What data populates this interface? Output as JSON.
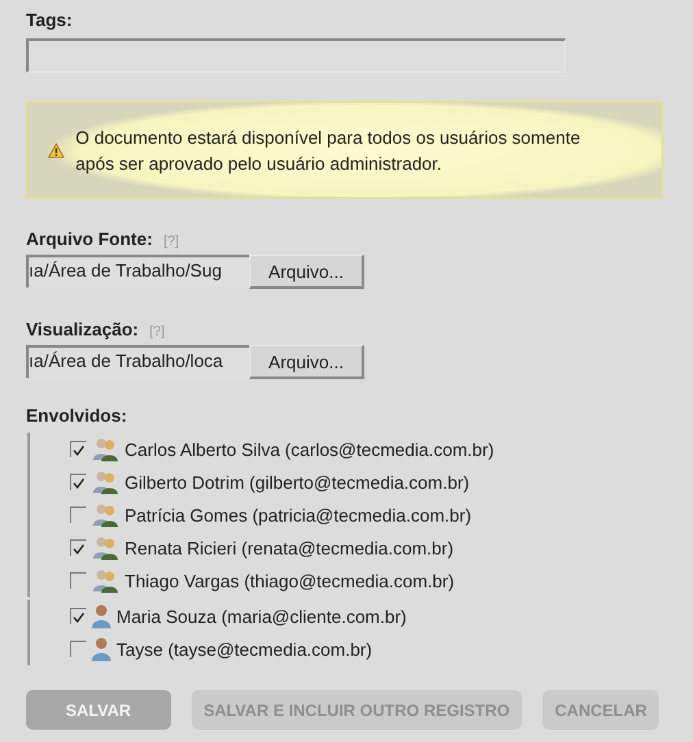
{
  "tags": {
    "label": "Tags:"
  },
  "warning": {
    "text": "O documento estará disponível para todos os usuários somente após ser aprovado pelo usuário administrador."
  },
  "files": [
    {
      "label": "Arquivo Fonte:",
      "help": "[?]",
      "value": "ıa/Área de Trabalho/Sug",
      "button": "Arquivo..."
    },
    {
      "label": "Visualização:",
      "help": "[?]",
      "value": "ıa/Área de Trabalho/loca",
      "button": "Arquivo..."
    }
  ],
  "involved": {
    "label": "Envolvidos:",
    "groups": [
      {
        "kind": "group",
        "members": [
          {
            "name": "Carlos Alberto Silva (carlos@tecmedia.com.br)",
            "checked": true
          },
          {
            "name": "Gilberto Dotrim (gilberto@tecmedia.com.br)",
            "checked": true
          },
          {
            "name": "Patrícia Gomes (patricia@tecmedia.com.br)",
            "checked": false
          },
          {
            "name": "Renata Ricieri (renata@tecmedia.com.br)",
            "checked": true
          },
          {
            "name": "Thiago Vargas (thiago@tecmedia.com.br)",
            "checked": false
          }
        ]
      },
      {
        "kind": "person",
        "members": [
          {
            "name": "Maria Souza (maria@cliente.com.br)",
            "checked": true
          },
          {
            "name": "Tayse (tayse@tecmedia.com.br)",
            "checked": false
          }
        ]
      }
    ]
  },
  "buttons": [
    {
      "label": "SALVAR",
      "kind": "primary"
    },
    {
      "label": "SALVAR E INCLUIR OUTRO REGISTRO",
      "kind": "secondary"
    },
    {
      "label": "CANCELAR",
      "kind": "secondary"
    }
  ]
}
